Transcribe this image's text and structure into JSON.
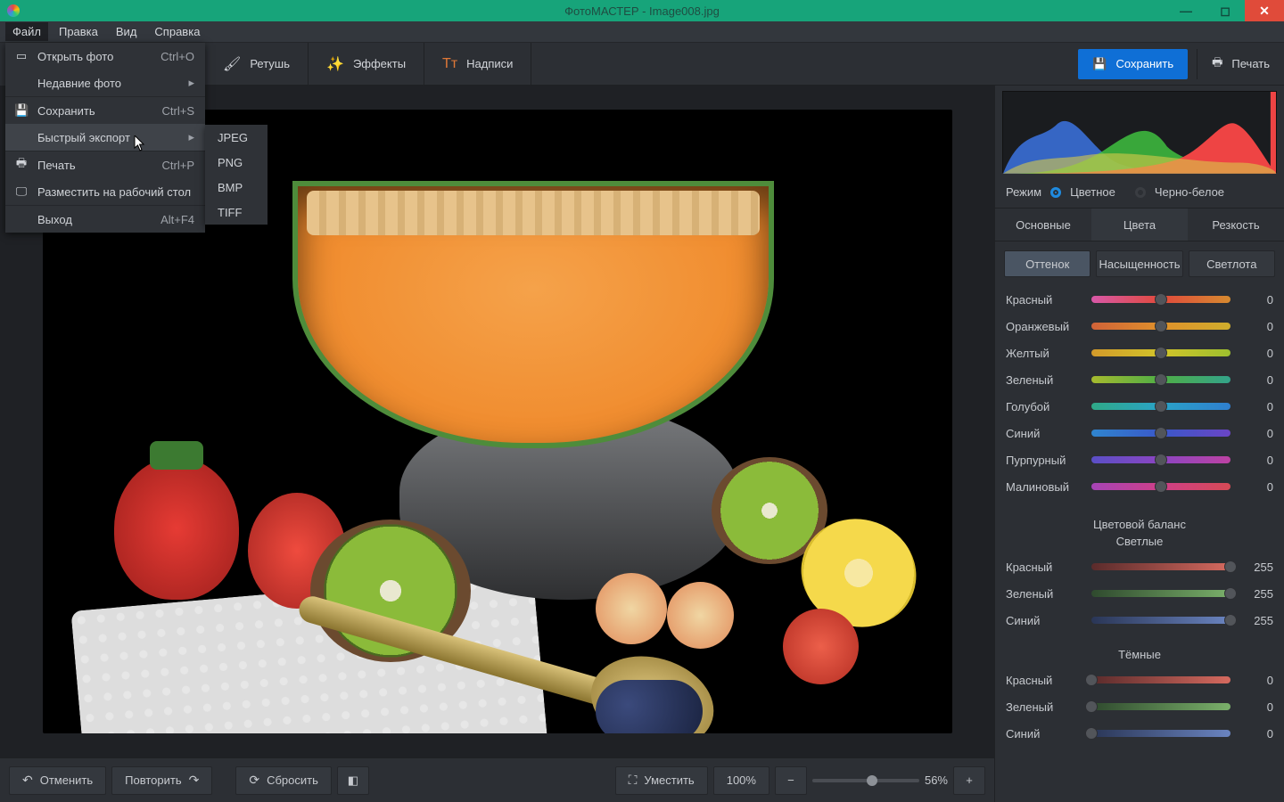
{
  "window": {
    "title": "ФотоМАСТЕР - Image008.jpg"
  },
  "menubar": {
    "file": "Файл",
    "edit": "Правка",
    "view": "Вид",
    "help": "Справка"
  },
  "file_menu": {
    "open": "Открыть фото",
    "open_sc": "Ctrl+O",
    "recent": "Недавние фото",
    "save": "Сохранить",
    "save_sc": "Ctrl+S",
    "quick_export": "Быстрый экспорт",
    "print": "Печать",
    "print_sc": "Ctrl+P",
    "set_wallpaper": "Разместить на рабочий стол",
    "exit": "Выход",
    "exit_sc": "Alt+F4",
    "export": {
      "jpeg": "JPEG",
      "png": "PNG",
      "bmp": "BMP",
      "tiff": "TIFF"
    }
  },
  "toolbar": {
    "retouch": "Ретушь",
    "effects": "Эффекты",
    "captions": "Надписи",
    "save": "Сохранить",
    "print": "Печать"
  },
  "panel": {
    "mode_label": "Режим",
    "mode_color": "Цветное",
    "mode_bw": "Черно-белое",
    "tabs": {
      "basic": "Основные",
      "colors": "Цвета",
      "sharp": "Резкость"
    },
    "subtabs": {
      "hue": "Оттенок",
      "sat": "Насыщенность",
      "lum": "Светлота"
    },
    "color_rows": [
      {
        "label": "Красный",
        "value": "0",
        "grad": "linear-gradient(90deg,#d858a8,#e14a3c,#d68a2f)"
      },
      {
        "label": "Оранжевый",
        "value": "0",
        "grad": "linear-gradient(90deg,#d06238,#e0912b,#cfad2c)"
      },
      {
        "label": "Желтый",
        "value": "0",
        "grad": "linear-gradient(90deg,#d39a2a,#d2c42a,#9dbf2e)"
      },
      {
        "label": "Зеленый",
        "value": "0",
        "grad": "linear-gradient(90deg,#a6ba2e,#4fae46,#33a38a)"
      },
      {
        "label": "Голубой",
        "value": "0",
        "grad": "linear-gradient(90deg,#2fa987,#2aa2c7,#2f7fcf)"
      },
      {
        "label": "Синий",
        "value": "0",
        "grad": "linear-gradient(90deg,#2f85ce,#3a58c9,#6a45c5)"
      },
      {
        "label": "Пурпурный",
        "value": "0",
        "grad": "linear-gradient(90deg,#5a4fc6,#8c45c2,#bd42a3)"
      },
      {
        "label": "Малиновый",
        "value": "0",
        "grad": "linear-gradient(90deg,#a644b6,#cf3f88,#d64a55)"
      }
    ],
    "balance_title": "Цветовой баланс",
    "lights_title": "Светлые",
    "darks_title": "Тёмные",
    "lights": [
      {
        "label": "Красный",
        "value": "255",
        "grad": "linear-gradient(90deg,#5a2b2b,#d66a5f)"
      },
      {
        "label": "Зеленый",
        "value": "255",
        "grad": "linear-gradient(90deg,#2f4a2e,#7ab06a)"
      },
      {
        "label": "Синий",
        "value": "255",
        "grad": "linear-gradient(90deg,#2a3656,#6a84c0)"
      }
    ],
    "darks": [
      {
        "label": "Красный",
        "value": "0",
        "grad": "linear-gradient(90deg,#5a2b2b,#d66a5f)"
      },
      {
        "label": "Зеленый",
        "value": "0",
        "grad": "linear-gradient(90deg,#2f4a2e,#7ab06a)"
      },
      {
        "label": "Синий",
        "value": "0",
        "grad": "linear-gradient(90deg,#2a3656,#6a84c0)"
      }
    ]
  },
  "bottom": {
    "undo": "Отменить",
    "redo": "Повторить",
    "reset": "Сбросить",
    "fit": "Уместить",
    "zoom_pct": "100%",
    "zoom_val": "56%"
  }
}
